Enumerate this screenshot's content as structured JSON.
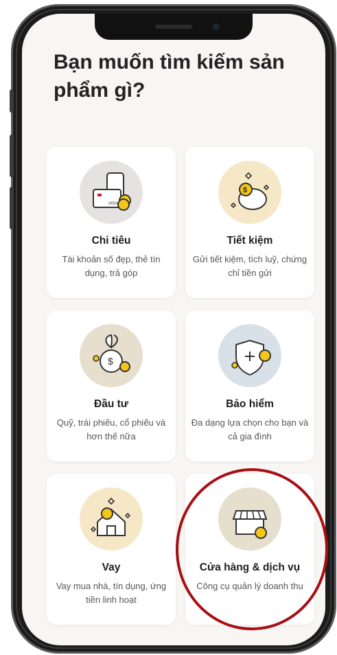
{
  "page": {
    "title": "Bạn muốn tìm kiếm sản phẩm gì?"
  },
  "cards": [
    {
      "title": "Chi tiêu",
      "description": "Tài khoản số đẹp, thẻ tín dụng, trả góp",
      "icon": "card-wallet-icon",
      "color": "#e4e3e1"
    },
    {
      "title": "Tiết kiệm",
      "description": "Gửi tiết kiệm, tích luỹ, chứng chỉ tiền gửi",
      "icon": "piggy-bank-icon",
      "color": "#f6e8c7"
    },
    {
      "title": "Đầu tư",
      "description": "Quỹ, trái phiếu, cổ phiếu và hơn thế nữa",
      "icon": "money-bag-sprout-icon",
      "color": "#e7dfcd"
    },
    {
      "title": "Bảo hiểm",
      "description": "Đa dạng lựa chọn cho bạn và cả gia đình",
      "icon": "shield-plus-icon",
      "color": "#d9e1e8"
    },
    {
      "title": "Vay",
      "description": "Vay mua nhà, tín dụng, ứng tiền linh hoạt",
      "icon": "house-coin-icon",
      "color": "#f6e8c7"
    },
    {
      "title": "Cửa hàng & dịch vụ",
      "description": "Công cụ quản lý doanh thu",
      "icon": "storefront-icon",
      "color": "#e7dfcd"
    }
  ],
  "annotation": {
    "color": "#a80e14"
  }
}
